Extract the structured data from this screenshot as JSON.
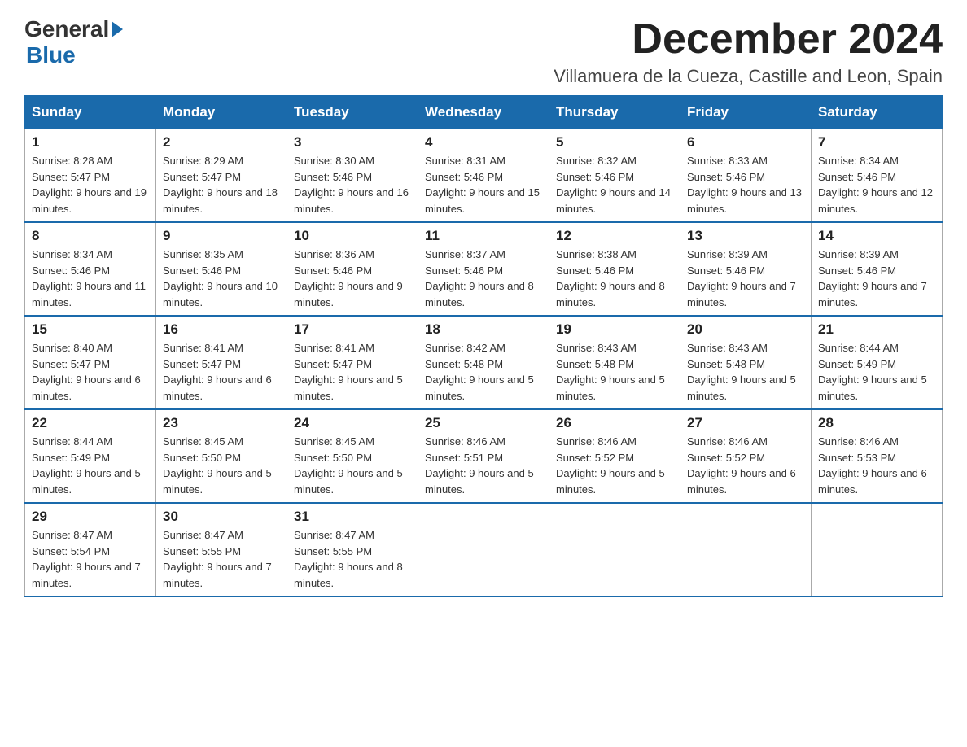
{
  "logo": {
    "general": "General",
    "blue": "Blue"
  },
  "header": {
    "month_year": "December 2024",
    "location": "Villamuera de la Cueza, Castille and Leon, Spain"
  },
  "weekdays": [
    "Sunday",
    "Monday",
    "Tuesday",
    "Wednesday",
    "Thursday",
    "Friday",
    "Saturday"
  ],
  "weeks": [
    [
      {
        "day": "1",
        "sunrise": "8:28 AM",
        "sunset": "5:47 PM",
        "daylight": "9 hours and 19 minutes."
      },
      {
        "day": "2",
        "sunrise": "8:29 AM",
        "sunset": "5:47 PM",
        "daylight": "9 hours and 18 minutes."
      },
      {
        "day": "3",
        "sunrise": "8:30 AM",
        "sunset": "5:46 PM",
        "daylight": "9 hours and 16 minutes."
      },
      {
        "day": "4",
        "sunrise": "8:31 AM",
        "sunset": "5:46 PM",
        "daylight": "9 hours and 15 minutes."
      },
      {
        "day": "5",
        "sunrise": "8:32 AM",
        "sunset": "5:46 PM",
        "daylight": "9 hours and 14 minutes."
      },
      {
        "day": "6",
        "sunrise": "8:33 AM",
        "sunset": "5:46 PM",
        "daylight": "9 hours and 13 minutes."
      },
      {
        "day": "7",
        "sunrise": "8:34 AM",
        "sunset": "5:46 PM",
        "daylight": "9 hours and 12 minutes."
      }
    ],
    [
      {
        "day": "8",
        "sunrise": "8:34 AM",
        "sunset": "5:46 PM",
        "daylight": "9 hours and 11 minutes."
      },
      {
        "day": "9",
        "sunrise": "8:35 AM",
        "sunset": "5:46 PM",
        "daylight": "9 hours and 10 minutes."
      },
      {
        "day": "10",
        "sunrise": "8:36 AM",
        "sunset": "5:46 PM",
        "daylight": "9 hours and 9 minutes."
      },
      {
        "day": "11",
        "sunrise": "8:37 AM",
        "sunset": "5:46 PM",
        "daylight": "9 hours and 8 minutes."
      },
      {
        "day": "12",
        "sunrise": "8:38 AM",
        "sunset": "5:46 PM",
        "daylight": "9 hours and 8 minutes."
      },
      {
        "day": "13",
        "sunrise": "8:39 AM",
        "sunset": "5:46 PM",
        "daylight": "9 hours and 7 minutes."
      },
      {
        "day": "14",
        "sunrise": "8:39 AM",
        "sunset": "5:46 PM",
        "daylight": "9 hours and 7 minutes."
      }
    ],
    [
      {
        "day": "15",
        "sunrise": "8:40 AM",
        "sunset": "5:47 PM",
        "daylight": "9 hours and 6 minutes."
      },
      {
        "day": "16",
        "sunrise": "8:41 AM",
        "sunset": "5:47 PM",
        "daylight": "9 hours and 6 minutes."
      },
      {
        "day": "17",
        "sunrise": "8:41 AM",
        "sunset": "5:47 PM",
        "daylight": "9 hours and 5 minutes."
      },
      {
        "day": "18",
        "sunrise": "8:42 AM",
        "sunset": "5:48 PM",
        "daylight": "9 hours and 5 minutes."
      },
      {
        "day": "19",
        "sunrise": "8:43 AM",
        "sunset": "5:48 PM",
        "daylight": "9 hours and 5 minutes."
      },
      {
        "day": "20",
        "sunrise": "8:43 AM",
        "sunset": "5:48 PM",
        "daylight": "9 hours and 5 minutes."
      },
      {
        "day": "21",
        "sunrise": "8:44 AM",
        "sunset": "5:49 PM",
        "daylight": "9 hours and 5 minutes."
      }
    ],
    [
      {
        "day": "22",
        "sunrise": "8:44 AM",
        "sunset": "5:49 PM",
        "daylight": "9 hours and 5 minutes."
      },
      {
        "day": "23",
        "sunrise": "8:45 AM",
        "sunset": "5:50 PM",
        "daylight": "9 hours and 5 minutes."
      },
      {
        "day": "24",
        "sunrise": "8:45 AM",
        "sunset": "5:50 PM",
        "daylight": "9 hours and 5 minutes."
      },
      {
        "day": "25",
        "sunrise": "8:46 AM",
        "sunset": "5:51 PM",
        "daylight": "9 hours and 5 minutes."
      },
      {
        "day": "26",
        "sunrise": "8:46 AM",
        "sunset": "5:52 PM",
        "daylight": "9 hours and 5 minutes."
      },
      {
        "day": "27",
        "sunrise": "8:46 AM",
        "sunset": "5:52 PM",
        "daylight": "9 hours and 6 minutes."
      },
      {
        "day": "28",
        "sunrise": "8:46 AM",
        "sunset": "5:53 PM",
        "daylight": "9 hours and 6 minutes."
      }
    ],
    [
      {
        "day": "29",
        "sunrise": "8:47 AM",
        "sunset": "5:54 PM",
        "daylight": "9 hours and 7 minutes."
      },
      {
        "day": "30",
        "sunrise": "8:47 AM",
        "sunset": "5:55 PM",
        "daylight": "9 hours and 7 minutes."
      },
      {
        "day": "31",
        "sunrise": "8:47 AM",
        "sunset": "5:55 PM",
        "daylight": "9 hours and 8 minutes."
      },
      null,
      null,
      null,
      null
    ]
  ],
  "labels": {
    "sunrise_prefix": "Sunrise: ",
    "sunset_prefix": "Sunset: ",
    "daylight_prefix": "Daylight: "
  }
}
